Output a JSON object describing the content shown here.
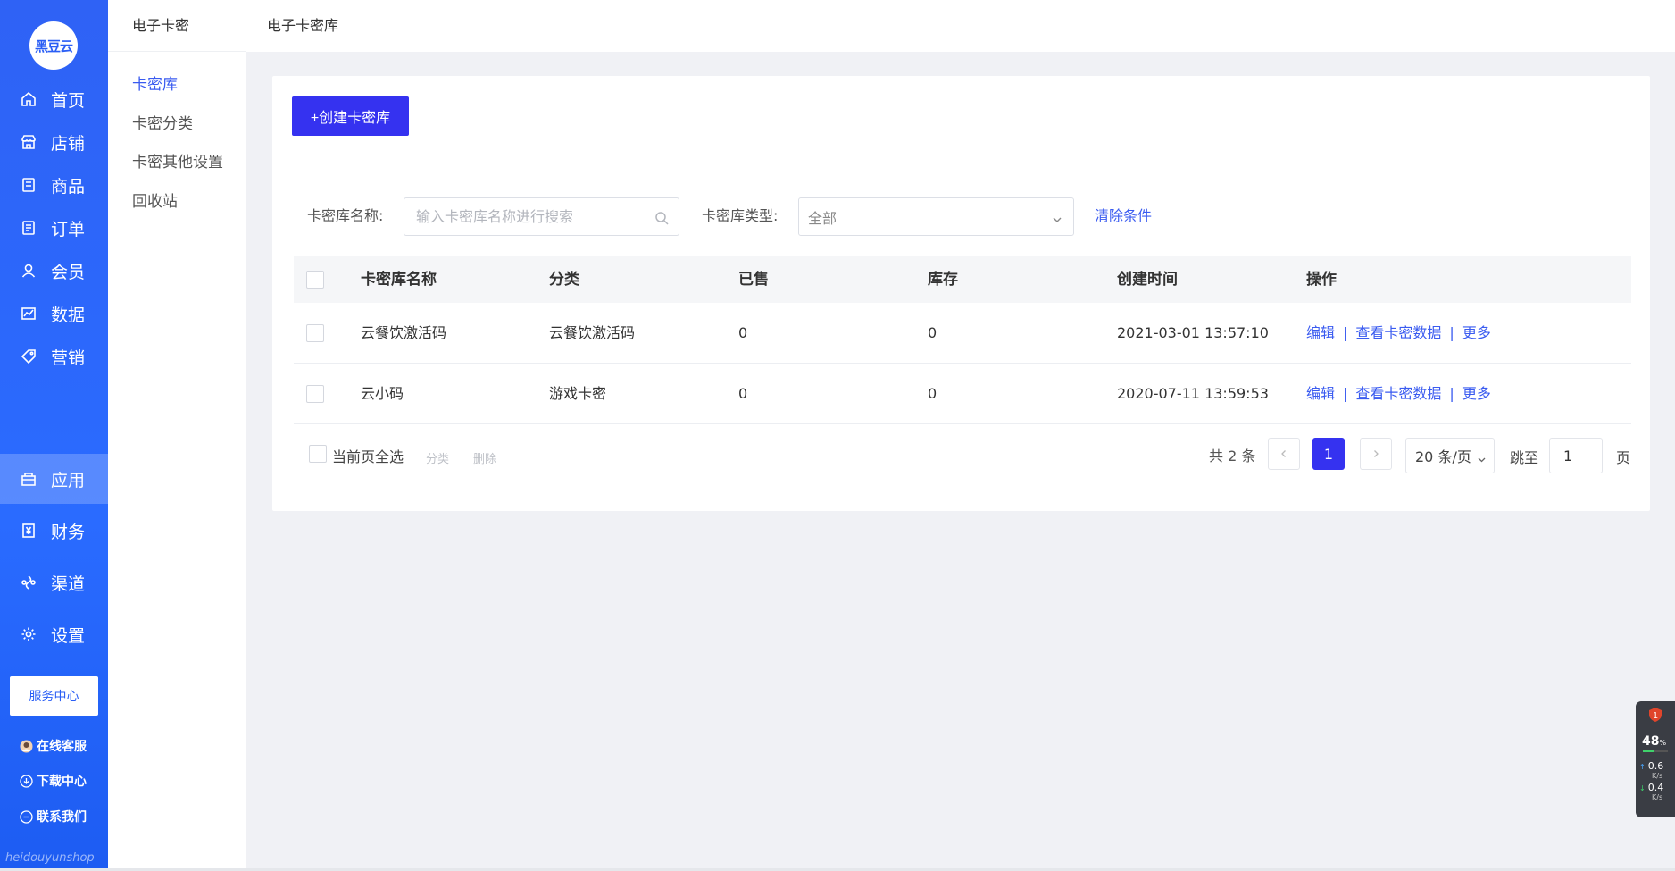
{
  "logo": {
    "text": "黑豆云"
  },
  "nav": {
    "items": [
      {
        "label": "首页",
        "icon": "home-icon"
      },
      {
        "label": "店铺",
        "icon": "shop-icon"
      },
      {
        "label": "商品",
        "icon": "goods-icon"
      },
      {
        "label": "订单",
        "icon": "order-icon"
      },
      {
        "label": "会员",
        "icon": "user-icon"
      },
      {
        "label": "数据",
        "icon": "chart-icon"
      },
      {
        "label": "营销",
        "icon": "tag-icon"
      },
      {
        "label": "应用",
        "icon": "app-icon",
        "active": true
      },
      {
        "label": "财务",
        "icon": "yen-icon"
      },
      {
        "label": "渠道",
        "icon": "channel-icon"
      },
      {
        "label": "设置",
        "icon": "gear-icon"
      }
    ],
    "service_center": "服务中心",
    "links": [
      {
        "label": "在线客服",
        "icon": "avatar-icon"
      },
      {
        "label": "下载中心",
        "icon": "download-icon"
      },
      {
        "label": "联系我们",
        "icon": "contact-icon"
      }
    ],
    "footer_brand": "heidouyunshop"
  },
  "subnav": {
    "title": "电子卡密",
    "items": [
      {
        "label": "卡密库",
        "active": true
      },
      {
        "label": "卡密分类"
      },
      {
        "label": "卡密其他设置"
      },
      {
        "label": "回收站"
      }
    ]
  },
  "topbar": {
    "breadcrumb": "电子卡密库"
  },
  "toolbar": {
    "create_label": "+创建卡密库"
  },
  "filters": {
    "name_label": "卡密库名称:",
    "name_placeholder": "输入卡密库名称进行搜索",
    "name_value": "",
    "type_label": "卡密库类型:",
    "type_value": "全部",
    "clear_label": "清除条件"
  },
  "table": {
    "columns": [
      "卡密库名称",
      "分类",
      "已售",
      "库存",
      "创建时间",
      "操作"
    ],
    "rows": [
      {
        "name": "云餐饮激活码",
        "category": "云餐饮激活码",
        "sold": "0",
        "stock": "0",
        "created": "2021-03-01 13:57:10"
      },
      {
        "name": "云小码",
        "category": "游戏卡密",
        "sold": "0",
        "stock": "0",
        "created": "2020-07-11 13:59:53"
      }
    ],
    "row_actions": {
      "edit": "编辑",
      "view": "查看卡密数据",
      "more": "更多"
    }
  },
  "footer": {
    "select_all_label": "当前页全选",
    "batch_category": "分类",
    "batch_delete": "删除",
    "total_text": "共 2 条",
    "current_page": "1",
    "page_size": "20 条/页",
    "jump_label": "跳至",
    "jump_value": "1",
    "page_suffix": "页"
  },
  "widget": {
    "badge": "1",
    "percent": "48",
    "percent_unit": "%",
    "percent_level": 0.48,
    "up_speed": "0.6",
    "down_speed": "0.4",
    "speed_unit": "K/s"
  },
  "colors": {
    "nav_bg": "#2a6bff",
    "primary": "#3532f0",
    "link": "#3a5bf0",
    "page_bg": "#f0f1f5"
  }
}
